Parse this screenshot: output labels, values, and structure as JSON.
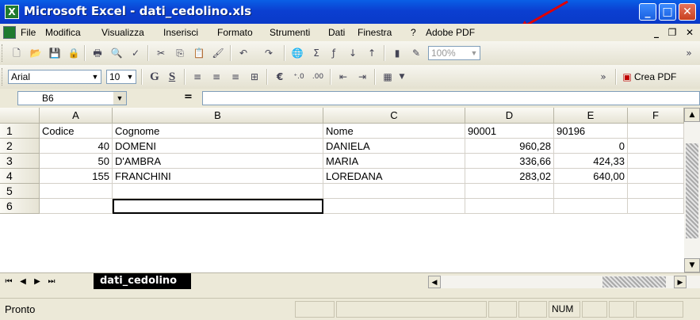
{
  "window": {
    "title": "Microsoft Excel - dati_cedolino.xls",
    "app_icon": "excel-icon"
  },
  "menu": [
    "File",
    "Modifica",
    "Visualizza",
    "Inserisci",
    "Formato",
    "Strumenti",
    "Dati",
    "Finestra",
    "?",
    "Adobe PDF"
  ],
  "toolbar1": {
    "zoom": "100%"
  },
  "toolbar2": {
    "font": "Arial",
    "size": "10",
    "bold": "G",
    "underline": "S",
    "euro": "€",
    "create_pdf": "Crea PDF"
  },
  "formula_bar": {
    "name_box": "B6",
    "equals": "=",
    "formula": ""
  },
  "grid": {
    "columns": [
      "A",
      "B",
      "C",
      "D",
      "E",
      "F"
    ],
    "row_numbers": [
      "1",
      "2",
      "3",
      "4",
      "5",
      "6"
    ],
    "rows": [
      [
        "Codice",
        "Cognome",
        "Nome",
        "90001",
        "90196",
        ""
      ],
      [
        "40",
        "DOMENI",
        "DANIELA",
        "960,28",
        "0",
        ""
      ],
      [
        "50",
        "D'AMBRA",
        "MARIA",
        "336,66",
        "424,33",
        ""
      ],
      [
        "155",
        "FRANCHINI",
        "LOREDANA",
        "283,02",
        "640,00",
        ""
      ],
      [
        "",
        "",
        "",
        "",
        "",
        ""
      ],
      [
        "",
        "",
        "",
        "",
        "",
        ""
      ]
    ]
  },
  "sheet_tab": "dati_cedolino",
  "status": {
    "text": "Pronto",
    "num": "NUM"
  },
  "annotation_color": "#e00000"
}
